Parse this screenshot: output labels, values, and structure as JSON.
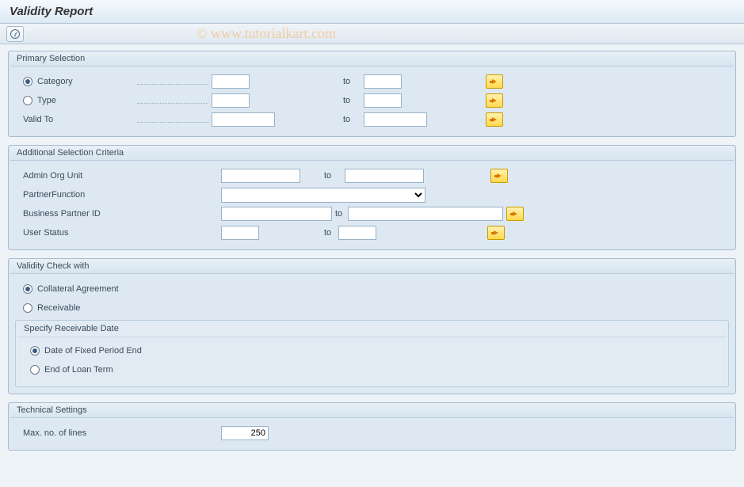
{
  "title": "Validity Report",
  "watermark": "© www.tutorialkart.com",
  "primary": {
    "title": "Primary Selection",
    "category": {
      "label": "Category",
      "from": "",
      "to_label": "to",
      "to": ""
    },
    "type": {
      "label": "Type",
      "from": "",
      "to_label": "to",
      "to": ""
    },
    "valid_to": {
      "label": "Valid To",
      "from": "",
      "to_label": "to",
      "to": ""
    }
  },
  "additional": {
    "title": "Additional Selection Criteria",
    "admin": {
      "label": "Admin Org Unit",
      "from": "",
      "to_label": "to",
      "to": ""
    },
    "partnerfn": {
      "label": "PartnerFunction",
      "value": ""
    },
    "bpid": {
      "label": "Business Partner ID",
      "from": "",
      "to_label": "to",
      "to": ""
    },
    "ustatus": {
      "label": "User Status",
      "from": "",
      "to_label": "to",
      "to": ""
    }
  },
  "validity": {
    "title": "Validity Check with",
    "opt_collateral": "Collateral Agreement",
    "opt_receivable": "Receivable",
    "selected": "collateral",
    "specify": {
      "title": "Specify Receivable Date",
      "opt_fixed": "Date of Fixed Period End",
      "opt_end": "End of Loan Term",
      "selected": "fixed"
    }
  },
  "technical": {
    "title": "Technical Settings",
    "max_lines": {
      "label": "Max. no. of lines",
      "value": "250"
    }
  },
  "to_word": "to"
}
